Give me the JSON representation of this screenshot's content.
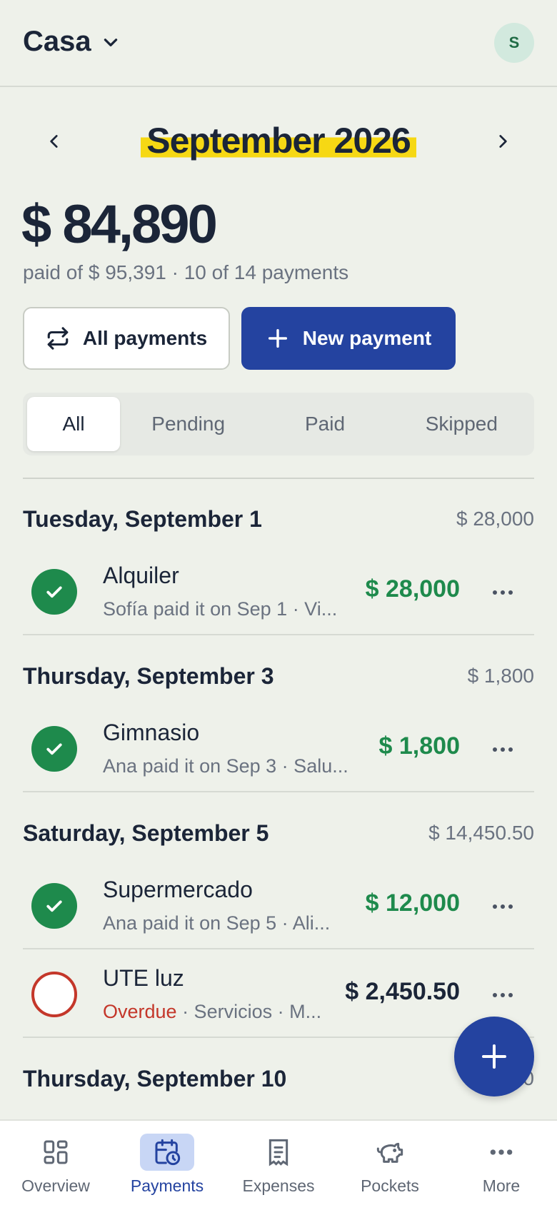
{
  "header": {
    "household": "Casa",
    "avatar_initial": "S"
  },
  "month": {
    "title": "September 2026"
  },
  "summary": {
    "total": "$ 84,890",
    "subtitle": "paid of $ 95,391 · 10 of 14 payments"
  },
  "actions": {
    "all_payments": "All payments",
    "new_payment": "New payment"
  },
  "tabs": [
    {
      "label": "All",
      "active": true
    },
    {
      "label": "Pending",
      "active": false
    },
    {
      "label": "Paid",
      "active": false
    },
    {
      "label": "Skipped",
      "active": false
    }
  ],
  "days": [
    {
      "title": "Tuesday, September 1",
      "total": "$ 28,000",
      "payments": [
        {
          "name": "Alquiler",
          "detail": "Sofía paid it on Sep 1 · Vi...",
          "amount": "$ 28,000",
          "status": "paid"
        }
      ]
    },
    {
      "title": "Thursday, September 3",
      "total": "$ 1,800",
      "payments": [
        {
          "name": "Gimnasio",
          "detail": "Ana paid it on Sep 3 · Salu...",
          "amount": "$ 1,800",
          "status": "paid"
        }
      ]
    },
    {
      "title": "Saturday, September 5",
      "total": "$ 14,450.50",
      "payments": [
        {
          "name": "Supermercado",
          "detail": "Ana paid it on Sep 5 · Ali...",
          "amount": "$ 12,000",
          "status": "paid"
        },
        {
          "name": "UTE luz",
          "overdue_label": "Overdue",
          "detail": " · Servicios · M...",
          "amount": "$ 2,450.50",
          "status": "overdue"
        }
      ]
    },
    {
      "title": "Thursday, September 10",
      "total": "0"
    }
  ],
  "bottom_nav": [
    {
      "label": "Overview",
      "icon": "grid-icon"
    },
    {
      "label": "Payments",
      "icon": "calendar-clock-icon",
      "active": true
    },
    {
      "label": "Expenses",
      "icon": "receipt-icon"
    },
    {
      "label": "Pockets",
      "icon": "piggy-bank-icon"
    },
    {
      "label": "More",
      "icon": "more-horizontal-icon"
    }
  ],
  "colors": {
    "primary": "#2443a0",
    "paid_green": "#1e8a4c",
    "overdue_red": "#c4372a",
    "highlight": "#f6d814",
    "background": "#eef1ea"
  }
}
